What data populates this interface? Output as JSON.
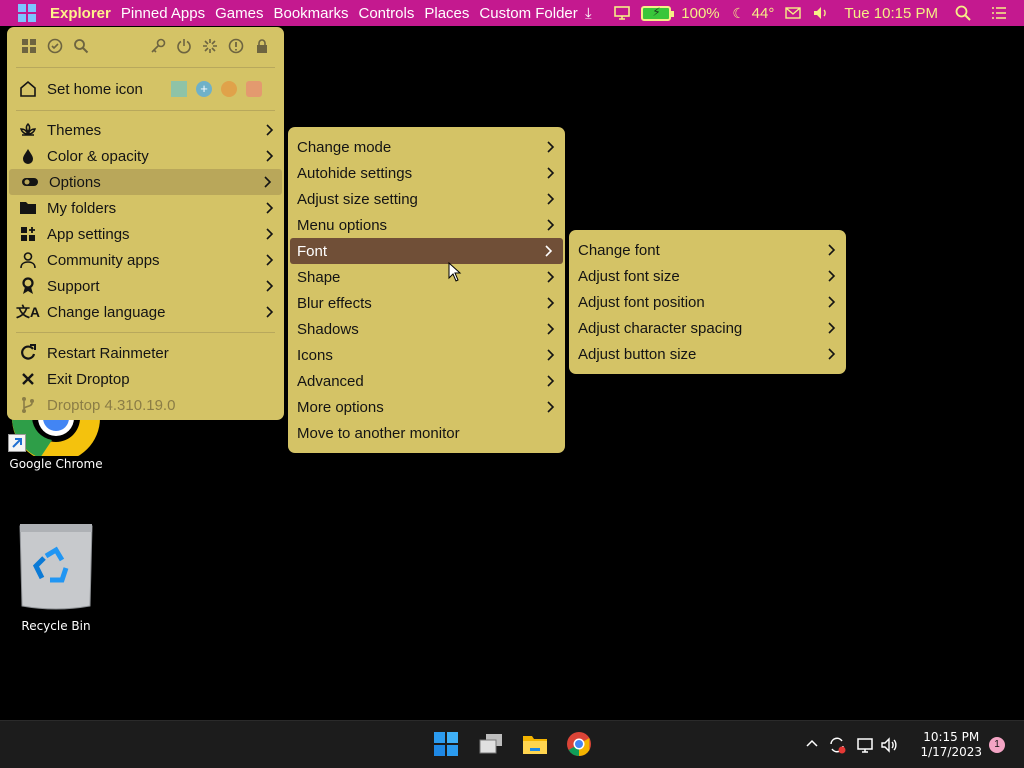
{
  "topbar": {
    "items": [
      "Explorer",
      "Pinned Apps",
      "Games",
      "Bookmarks",
      "Controls",
      "Places",
      "Custom Folder"
    ],
    "battery": "100%",
    "weather": "44°",
    "datetime": "Tue 10:15 PM",
    "colors": {
      "bar": "#c4198f",
      "active": "#fff28a",
      "accent_text": "#f6ef86"
    }
  },
  "main_menu": {
    "toolbar_icons": [
      "grid-icon",
      "check-circle-icon",
      "search-icon",
      "key-icon",
      "power-icon",
      "brightness-icon",
      "info-icon",
      "lock-icon"
    ],
    "home_label": "Set home icon",
    "items": [
      {
        "label": "Themes",
        "icon": "lotus-icon"
      },
      {
        "label": "Color & opacity",
        "icon": "drop-icon"
      },
      {
        "label": "Options",
        "icon": "toggle-icon"
      },
      {
        "label": "My folders",
        "icon": "folder-icon"
      },
      {
        "label": "App settings",
        "icon": "apps-icon"
      },
      {
        "label": "Community apps",
        "icon": "person-icon"
      },
      {
        "label": "Support",
        "icon": "ribbon-icon"
      },
      {
        "label": "Change language",
        "icon": "translate-icon"
      }
    ],
    "bottom_items": [
      {
        "label": "Restart Rainmeter",
        "icon": "refresh-icon"
      },
      {
        "label": "Exit Droptop",
        "icon": "close-icon"
      },
      {
        "label": "Droptop 4.310.19.0",
        "icon": "branch-icon"
      }
    ]
  },
  "options_menu": {
    "items": [
      "Change mode",
      "Autohide settings",
      "Adjust size setting",
      "Menu options",
      "Font",
      "Shape",
      "Blur effects",
      "Shadows",
      "Icons",
      "Advanced",
      "More options",
      "Move to another monitor"
    ]
  },
  "font_menu": {
    "items": [
      "Change font",
      "Adjust font size",
      "Adjust font position",
      "Adjust character spacing",
      "Adjust button size"
    ]
  },
  "desktop": {
    "icons": [
      {
        "label": "Google Chrome",
        "icon": "chrome-icon"
      },
      {
        "label": "Recycle Bin",
        "icon": "recycle-bin-icon"
      }
    ]
  },
  "taskbar": {
    "apps": [
      "windows-start-icon",
      "task-view-icon",
      "file-explorer-icon",
      "chrome-icon"
    ],
    "tray_icons": [
      "chevron-up-icon",
      "sync-icon",
      "network-icon",
      "volume-icon"
    ],
    "time": "10:15 PM",
    "date": "1/17/2023",
    "notifications": "1"
  },
  "colors": {
    "menu_bg": "#d4c366",
    "menu_hl_light": "#b9a75a",
    "menu_hl_dark": "#704f37",
    "desktop": "#000000"
  }
}
